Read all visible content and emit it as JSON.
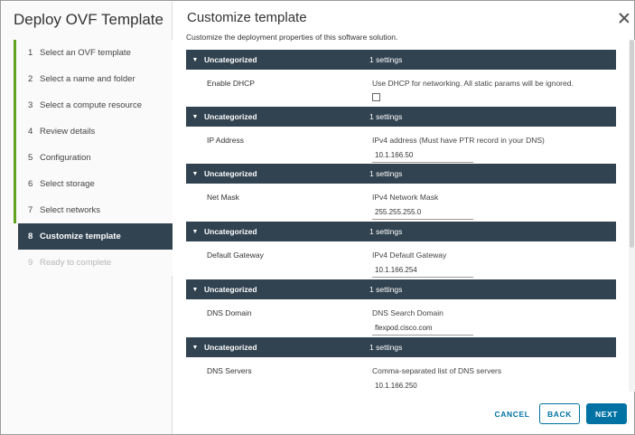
{
  "wizard": {
    "title": "Deploy OVF Template",
    "steps": [
      {
        "num": "1",
        "label": "Select an OVF template"
      },
      {
        "num": "2",
        "label": "Select a name and folder"
      },
      {
        "num": "3",
        "label": "Select a compute resource"
      },
      {
        "num": "4",
        "label": "Review details"
      },
      {
        "num": "5",
        "label": "Configuration"
      },
      {
        "num": "6",
        "label": "Select storage"
      },
      {
        "num": "7",
        "label": "Select networks"
      },
      {
        "num": "8",
        "label": "Customize template"
      },
      {
        "num": "9",
        "label": "Ready to complete"
      }
    ]
  },
  "main": {
    "title": "Customize template",
    "subtitle": "Customize the deployment properties of this software solution.",
    "groups": [
      {
        "name": "Uncategorized",
        "count": "1 settings",
        "label": "Enable DHCP",
        "desc": "Use DHCP for networking. All static params will be ignored.",
        "type": "checkbox",
        "checked": false
      },
      {
        "name": "Uncategorized",
        "count": "1 settings",
        "label": "IP Address",
        "desc": "IPv4 address (Must have PTR record in your DNS)",
        "value": "10.1.166.50"
      },
      {
        "name": "Uncategorized",
        "count": "1 settings",
        "label": "Net Mask",
        "desc": "IPv4 Network Mask",
        "value": "255.255.255.0"
      },
      {
        "name": "Uncategorized",
        "count": "1 settings",
        "label": "Default Gateway",
        "desc": "IPv4 Default Gateway",
        "value": "10.1.166.254"
      },
      {
        "name": "Uncategorized",
        "count": "1 settings",
        "label": "DNS Domain",
        "desc": "DNS Search Domain",
        "value": "flexpod.cisco.com"
      },
      {
        "name": "Uncategorized",
        "count": "1 settings",
        "label": "DNS Servers",
        "desc": "Comma-separated list of DNS servers",
        "value": "10.1.166.250"
      }
    ]
  },
  "footer": {
    "cancel": "CANCEL",
    "back": "BACK",
    "next": "NEXT"
  },
  "colors": {
    "accent": "#0072a3",
    "header_bg": "#314351",
    "step_done": "#62a420"
  },
  "icons": {
    "close": "close-icon",
    "group_toggle": "chevron-down-icon"
  }
}
